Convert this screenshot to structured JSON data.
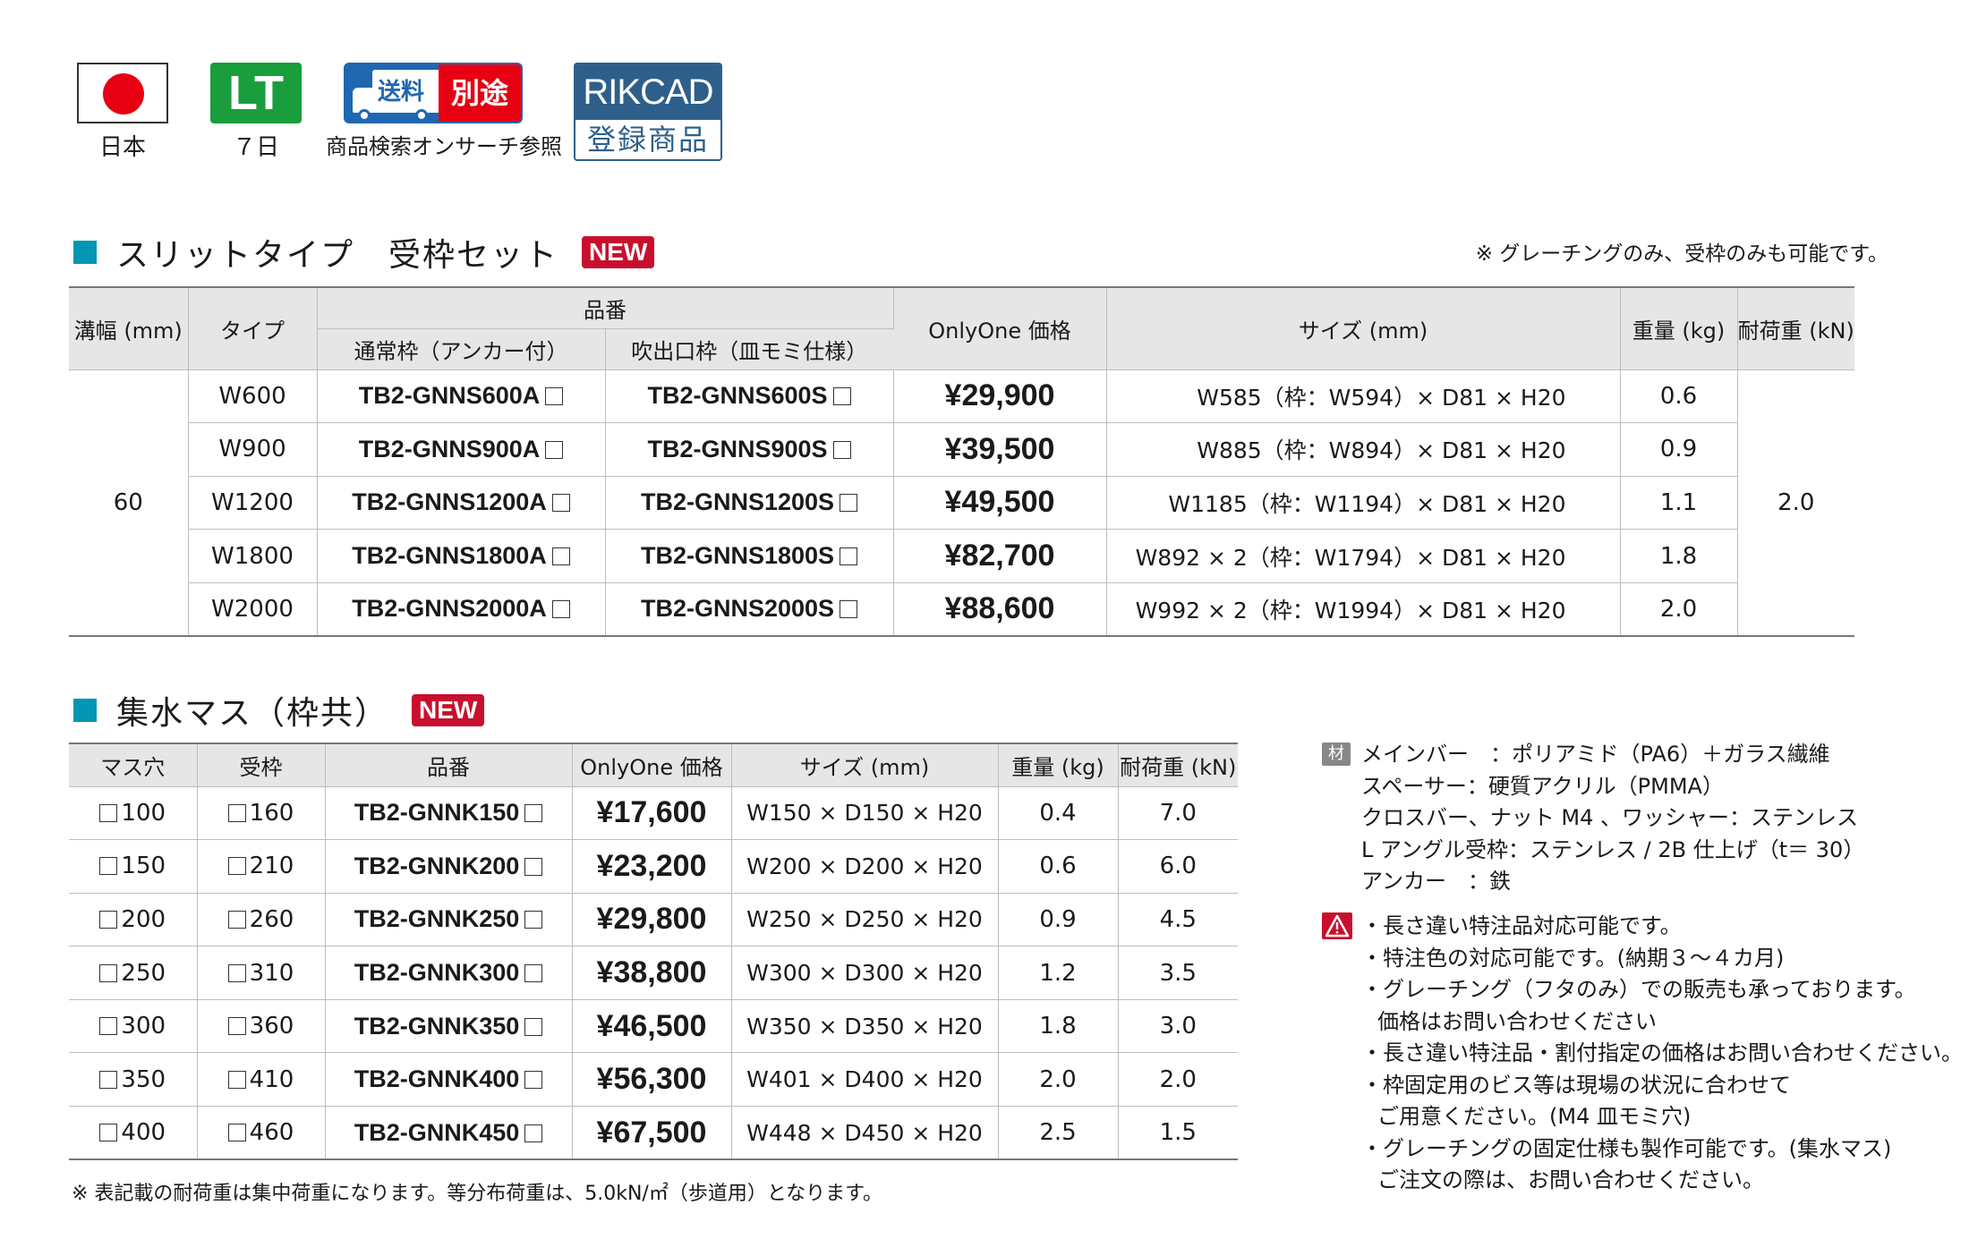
{
  "badges": {
    "origin_label": "日本",
    "lt_text": "LT",
    "lt_label": "７日",
    "shipping_left": "送料",
    "shipping_right": "別途",
    "shipping_label": "商品検索オンサーチ参照",
    "rikcad_top": "RIKCAD",
    "rikcad_bottom": "登録商品"
  },
  "section1": {
    "title": "スリットタイプ　受枠セット",
    "new_label": "NEW",
    "note": "※ グレーチングのみ、受枠のみも可能です。",
    "headers": {
      "width": "溝幅 (mm)",
      "type": "タイプ",
      "part_no": "品番",
      "part_normal": "通常枠（アンカー付）",
      "part_blowout": "吹出口枠（皿モミ仕様）",
      "price": "OnlyOne 価格",
      "size": "サイズ (mm)",
      "weight": "重量 (kg)",
      "load": "耐荷重 (kN)"
    },
    "groove_width": "60",
    "load": "2.0",
    "rows": [
      {
        "type": "W600",
        "normal": "TB2-GNNS600A",
        "blowout": "TB2-GNNS600S",
        "price": "¥29,900",
        "size": "W585（枠：W594）× D81 × H20",
        "weight": "0.6"
      },
      {
        "type": "W900",
        "normal": "TB2-GNNS900A",
        "blowout": "TB2-GNNS900S",
        "price": "¥39,500",
        "size": "W885（枠：W894）× D81 × H20",
        "weight": "0.9"
      },
      {
        "type": "W1200",
        "normal": "TB2-GNNS1200A",
        "blowout": "TB2-GNNS1200S",
        "price": "¥49,500",
        "size": "W1185（枠：W1194）× D81 × H20",
        "weight": "1.1"
      },
      {
        "type": "W1800",
        "normal": "TB2-GNNS1800A",
        "blowout": "TB2-GNNS1800S",
        "price": "¥82,700",
        "size": "W892 × 2（枠：W1794）× D81 × H20",
        "weight": "1.8"
      },
      {
        "type": "W2000",
        "normal": "TB2-GNNS2000A",
        "blowout": "TB2-GNNS2000S",
        "price": "¥88,600",
        "size": "W992 × 2（枠：W1994）× D81 × H20",
        "weight": "2.0"
      }
    ]
  },
  "section2": {
    "title": "集水マス（枠共）",
    "new_label": "NEW",
    "headers": {
      "hole": "マス穴",
      "frame": "受枠",
      "part_no": "品番",
      "price": "OnlyOne 価格",
      "size": "サイズ (mm)",
      "weight": "重量 (kg)",
      "load": "耐荷重 (kN)"
    },
    "rows": [
      {
        "hole": "100",
        "frame": "160",
        "part": "TB2-GNNK150",
        "price": "¥17,600",
        "size": "W150 × D150 × H20",
        "weight": "0.4",
        "load": "7.0"
      },
      {
        "hole": "150",
        "frame": "210",
        "part": "TB2-GNNK200",
        "price": "¥23,200",
        "size": "W200 × D200 × H20",
        "weight": "0.6",
        "load": "6.0"
      },
      {
        "hole": "200",
        "frame": "260",
        "part": "TB2-GNNK250",
        "price": "¥29,800",
        "size": "W250 × D250 × H20",
        "weight": "0.9",
        "load": "4.5"
      },
      {
        "hole": "250",
        "frame": "310",
        "part": "TB2-GNNK300",
        "price": "¥38,800",
        "size": "W300 × D300 × H20",
        "weight": "1.2",
        "load": "3.5"
      },
      {
        "hole": "300",
        "frame": "360",
        "part": "TB2-GNNK350",
        "price": "¥46,500",
        "size": "W350 × D350 × H20",
        "weight": "1.8",
        "load": "3.0"
      },
      {
        "hole": "350",
        "frame": "410",
        "part": "TB2-GNNK400",
        "price": "¥56,300",
        "size": "W401 × D400 × H20",
        "weight": "2.0",
        "load": "2.0"
      },
      {
        "hole": "400",
        "frame": "460",
        "part": "TB2-GNNK450",
        "price": "¥67,500",
        "size": "W448 × D450 × H20",
        "weight": "2.5",
        "load": "1.5"
      }
    ],
    "footnote": "※ 表記載の耐荷重は集中荷重になります。等分布荷重は、5.0kN/㎡（歩道用）となります。"
  },
  "materials": {
    "icon_label": "材質",
    "lines": [
      "メインバー　：ポリアミド（PA6）＋ガラス繊維",
      "スペーサー：硬質アクリル（PMMA）",
      "クロスバー、ナット M4 、ワッシャー：ステンレス",
      "L アングル受枠：ステンレス / 2B 仕上げ（t＝ 30）",
      "アンカー　：鉄"
    ]
  },
  "cautions": {
    "lines": [
      "・長さ違い特注品対応可能です。",
      "・特注色の対応可能です。(納期３～４カ月)",
      "・グレーチング（フタのみ）での販売も承っております。",
      "価格はお問い合わせください",
      "・長さ違い特注品・割付指定の価格はお問い合わせください。",
      "・枠固定用のビス等は現場の状況に合わせて",
      "ご用意ください。(M4 皿モミ穴)",
      "・グレーチングの固定仕様も製作可能です。(集水マス)",
      "ご注文の際は、お問い合わせください。"
    ]
  }
}
